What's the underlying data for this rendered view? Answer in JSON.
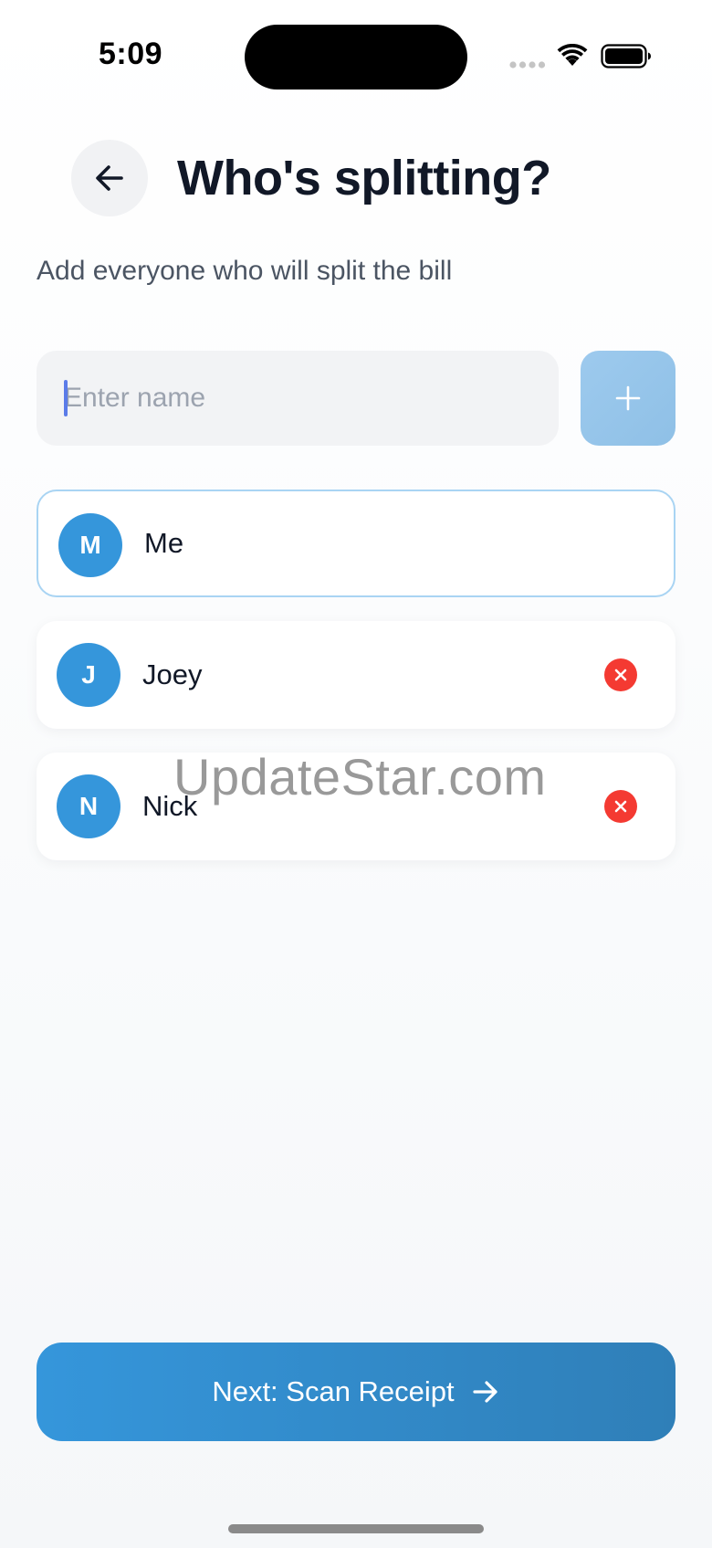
{
  "status_bar": {
    "time": "5:09"
  },
  "header": {
    "title": "Who's splitting?",
    "subtitle": "Add everyone who will split the bill",
    "back_icon": "arrow-left-icon"
  },
  "add_person": {
    "placeholder": "Enter name",
    "value": "",
    "add_icon": "plus-icon"
  },
  "participants": [
    {
      "initial": "M",
      "name": "Me",
      "removable": false
    },
    {
      "initial": "J",
      "name": "Joey",
      "removable": true
    },
    {
      "initial": "N",
      "name": "Nick",
      "removable": true
    }
  ],
  "watermark": "UpdateStar.com",
  "footer": {
    "next_label": "Next: Scan Receipt",
    "next_icon": "arrow-right-icon"
  },
  "colors": {
    "accent": "#3596db",
    "accent_disabled": "#9dcaee",
    "remove": "#f43a32",
    "me_border": "#a9d4f3"
  }
}
